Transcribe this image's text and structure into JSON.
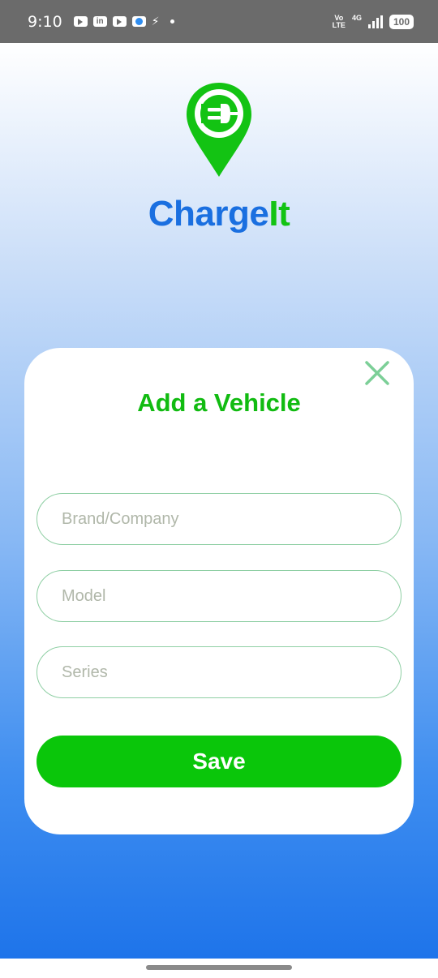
{
  "status_bar": {
    "time": "9:10",
    "left_icons": [
      "youtube-icon",
      "linkedin-icon",
      "youtube-icon",
      "weather-icon",
      "bolt-icon",
      "dot-icon"
    ],
    "linkedin_label": "in",
    "volte_line1": "Vo",
    "volte_line2": "LTE",
    "network": "4G",
    "battery": "100"
  },
  "app": {
    "name_part1": "Charge",
    "name_part2": "It",
    "logo_icon": "plug-location-pin-icon"
  },
  "dialog": {
    "title": "Add a Vehicle",
    "close_icon": "close-icon",
    "fields": [
      {
        "placeholder": "Brand/Company",
        "value": ""
      },
      {
        "placeholder": "Model",
        "value": ""
      },
      {
        "placeholder": "Series",
        "value": ""
      }
    ],
    "save_label": "Save"
  },
  "colors": {
    "brand_blue": "#1a6fe0",
    "brand_green": "#13c313",
    "button_green": "#0ac60a",
    "field_border": "#8fcfa4",
    "close_icon": "#7ccf97"
  }
}
